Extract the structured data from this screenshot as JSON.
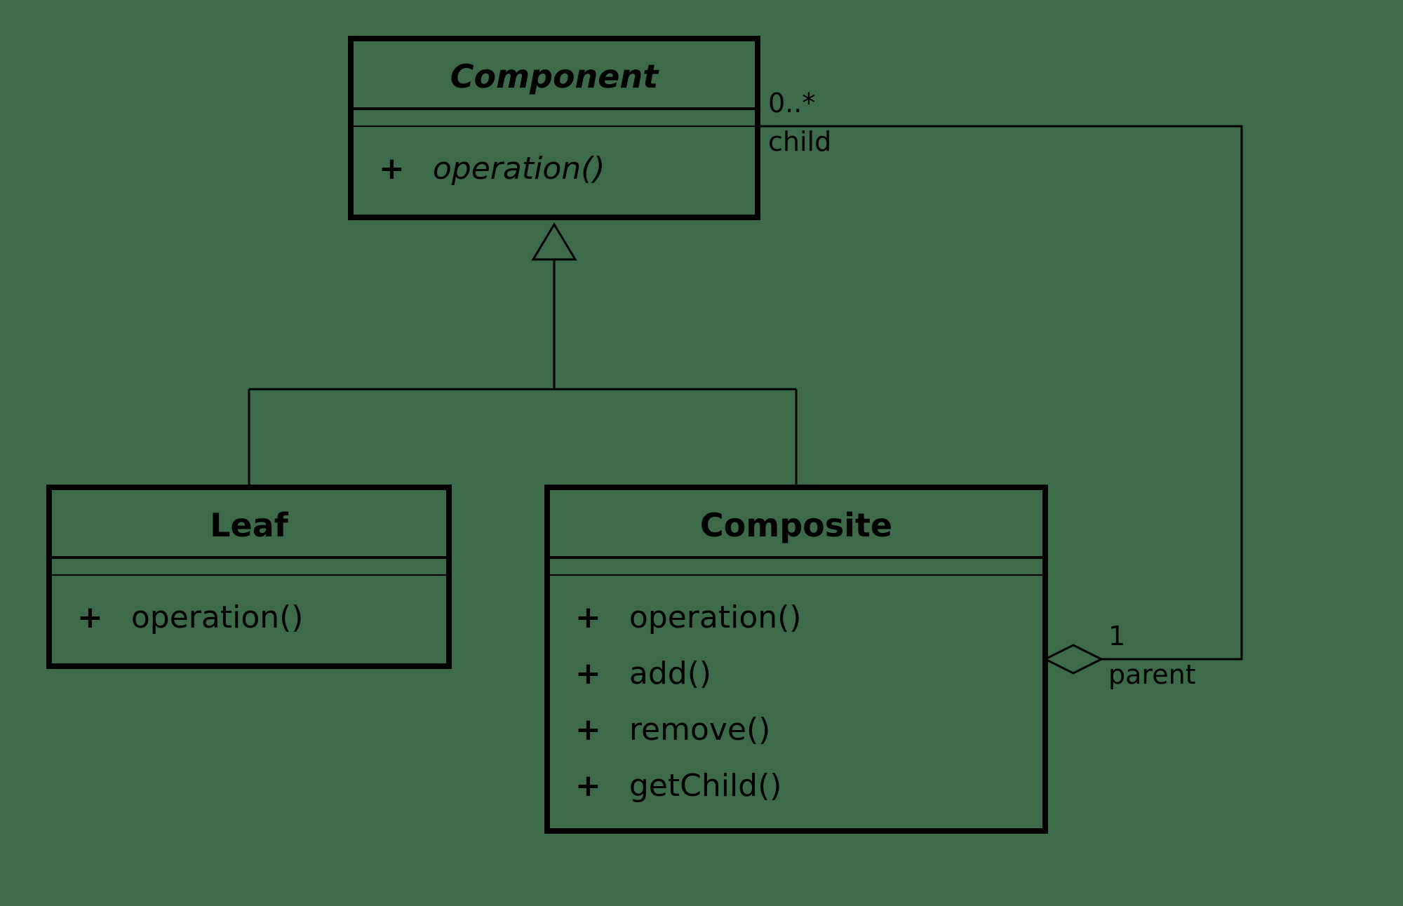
{
  "diagram": {
    "pattern_name": "Composite",
    "classes": {
      "component": {
        "name": "Component",
        "abstract": true,
        "methods": [
          {
            "visibility": "+",
            "signature": "operation()",
            "abstract": true
          }
        ]
      },
      "leaf": {
        "name": "Leaf",
        "abstract": false,
        "methods": [
          {
            "visibility": "+",
            "signature": "operation()",
            "abstract": false
          }
        ]
      },
      "composite": {
        "name": "Composite",
        "abstract": false,
        "methods": [
          {
            "visibility": "+",
            "signature": "operation()",
            "abstract": false
          },
          {
            "visibility": "+",
            "signature": "add()",
            "abstract": false
          },
          {
            "visibility": "+",
            "signature": "remove()",
            "abstract": false
          },
          {
            "visibility": "+",
            "signature": "getChild()",
            "abstract": false
          }
        ]
      }
    },
    "relationships": {
      "generalization": {
        "parent": "Component",
        "children": [
          "Leaf",
          "Composite"
        ]
      },
      "aggregation": {
        "whole": "Composite",
        "part": "Component",
        "whole_end": {
          "multiplicity": "1",
          "role": "parent"
        },
        "part_end": {
          "multiplicity": "0..*",
          "role": "child"
        }
      }
    }
  }
}
